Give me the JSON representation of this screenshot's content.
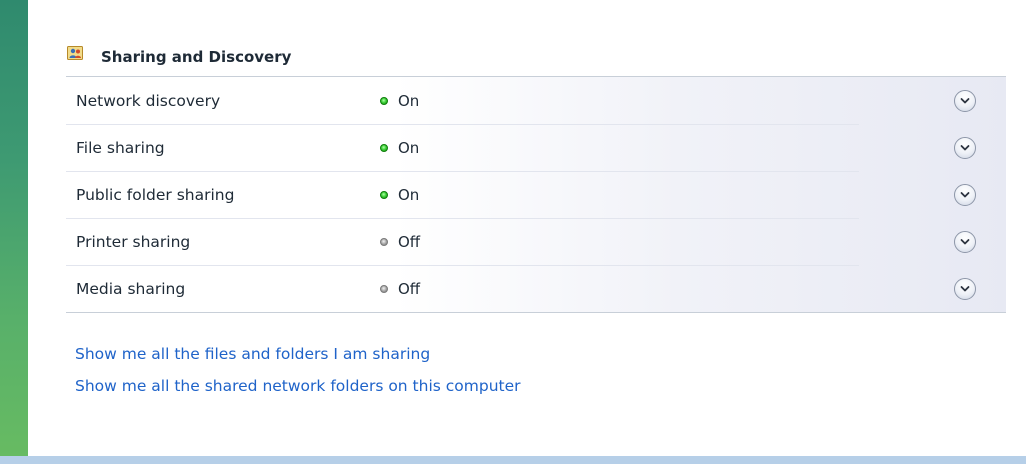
{
  "section": {
    "title": "Sharing and Discovery",
    "icon": "people-sharing-icon"
  },
  "settings": [
    {
      "label": "Network discovery",
      "status": "On",
      "state": "on"
    },
    {
      "label": "File sharing",
      "status": "On",
      "state": "on"
    },
    {
      "label": "Public folder sharing",
      "status": "On",
      "state": "on"
    },
    {
      "label": "Printer sharing",
      "status": "Off",
      "state": "off"
    },
    {
      "label": "Media sharing",
      "status": "Off",
      "state": "off"
    }
  ],
  "links": {
    "files_and_folders": "Show me all the files and folders I am sharing",
    "shared_network_folders": "Show me all the shared network folders on this computer"
  },
  "colors": {
    "link": "#1f63c9",
    "status_on": "#3ed13a",
    "status_off": "#a2a2a2",
    "left_bar": "#3e9a72",
    "bottom_bar": "#b6cfe8"
  }
}
